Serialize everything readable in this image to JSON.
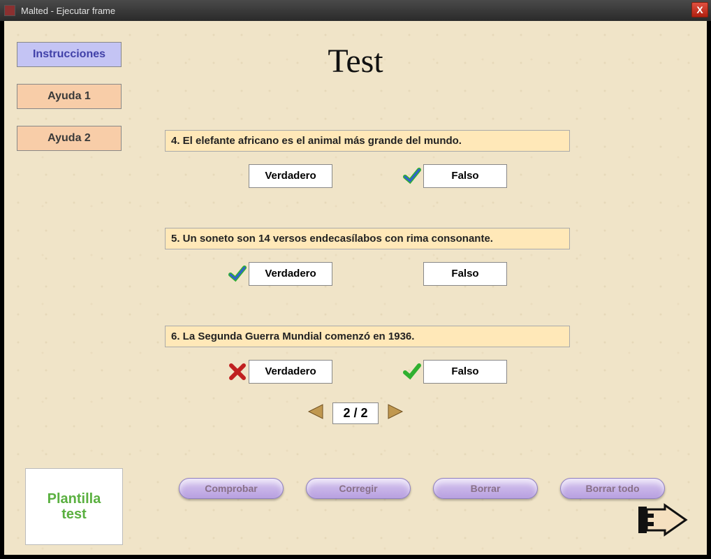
{
  "window": {
    "title": "Malted - Ejecutar frame"
  },
  "sidebar": {
    "instrucciones": "Instrucciones",
    "ayuda1": "Ayuda 1",
    "ayuda2": "Ayuda 2"
  },
  "title": "Test",
  "questions": [
    {
      "text": "4. El elefante africano es el animal más grande del mundo.",
      "true_label": "Verdadero",
      "false_label": "Falso",
      "true_mark": "none",
      "false_mark": "check-blue"
    },
    {
      "text": "5. Un soneto son 14 versos endecasílabos con rima consonante.",
      "true_label": "Verdadero",
      "false_label": "Falso",
      "true_mark": "check-blue",
      "false_mark": "none"
    },
    {
      "text": "6. La Segunda Guerra Mundial comenzó en 1936.",
      "true_label": "Verdadero",
      "false_label": "Falso",
      "true_mark": "cross",
      "false_mark": "check"
    }
  ],
  "pager": {
    "label": "2 / 2"
  },
  "bottom": {
    "comprobar": "Comprobar",
    "corregir": "Corregir",
    "borrar": "Borrar",
    "borrar_todo": "Borrar todo"
  },
  "plantilla": {
    "line1": "Plantilla",
    "line2": "test"
  }
}
